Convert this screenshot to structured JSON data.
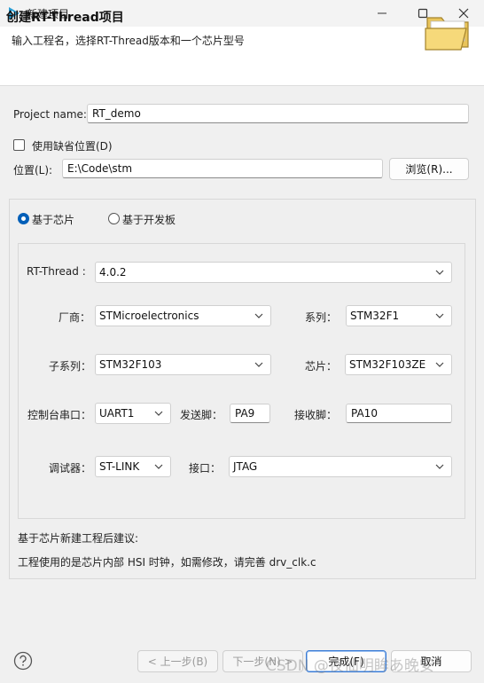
{
  "window": {
    "title": "新建项目",
    "min_icon": "minimize-icon",
    "max_icon": "maximize-icon",
    "close_icon": "close-icon"
  },
  "header": {
    "title": "创建RT-Thread项目",
    "description": "输入工程名，选择RT-Thread版本和一个芯片型号",
    "icon": "open-folder-icon"
  },
  "form": {
    "project_name_label": "Project name:",
    "project_name_value": "RT_demo",
    "use_default_location_label": "使用缺省位置(D)",
    "use_default_location_checked": false,
    "location_label": "位置(L):",
    "location_value": "E:\\Code\\stm",
    "browse_label": "浏览(R)..."
  },
  "mode": {
    "chip_label": "基于芯片",
    "board_label": "基于开发板",
    "selected": "chip"
  },
  "chip": {
    "rtthread_label": "RT-Thread :",
    "rtthread_value": "4.0.2",
    "vendor_label": "厂商：",
    "vendor_value": "STMicroelectronics",
    "series_label": "系列：",
    "series_value": "STM32F1",
    "subseries_label": "子系列：",
    "subseries_value": "STM32F103",
    "chip_label": "芯片：",
    "chip_value": "STM32F103ZE",
    "console_label": "控制台串口：",
    "console_value": "UART1",
    "tx_label": "发送脚：",
    "tx_value": "PA9",
    "rx_label": "接收脚：",
    "rx_value": "PA10",
    "debugger_label": "调试器：",
    "debugger_value": "ST-LINK",
    "interface_label": "接口：",
    "interface_value": "JTAG"
  },
  "advice": {
    "title": "基于芯片新建工程后建议:",
    "text": "工程使用的是芯片内部 HSI 时钟，如需修改，请完善 drv_clk.c"
  },
  "footer": {
    "help_icon": "help-icon",
    "back_label": "< 上一步(B)",
    "next_label": "下一步(N) >",
    "finish_label": "完成(F)",
    "cancel_label": "取消",
    "watermark": "CSDN @夜仙明眸あ晚安"
  },
  "colors": {
    "accent": "#005fb8",
    "header_bg": "#ffffff",
    "dialog_bg": "#f0f0f0"
  }
}
